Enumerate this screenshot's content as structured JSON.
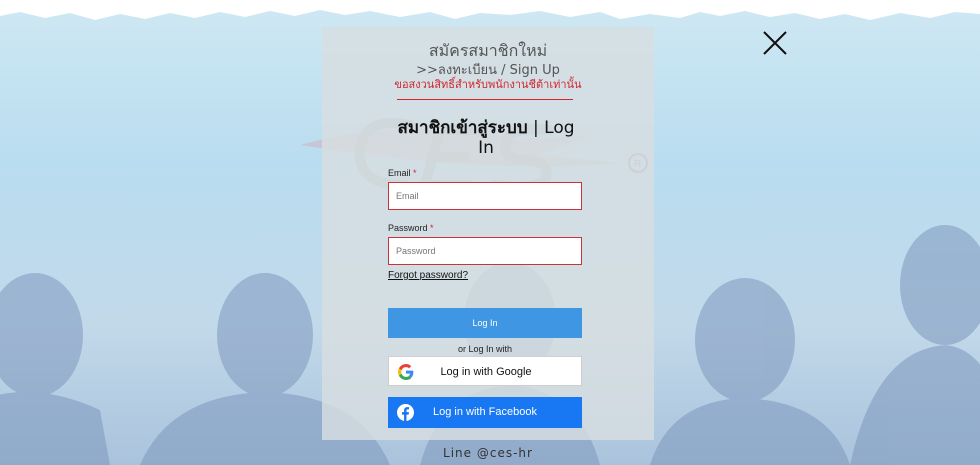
{
  "signup": {
    "title": "สมัครสมาชิกใหม่",
    "link": ">>ลงทะเบียน / Sign Up",
    "note": "ขอสงวนสิทธิ์สำหรับพนักงานชีต้าเท่านั้น"
  },
  "login": {
    "title_thai": "สมาชิกเข้าสู่ระบบ",
    "title_en": " | Log In",
    "email": {
      "label": "Email",
      "required_mark": "*",
      "placeholder": "Email",
      "value": ""
    },
    "password": {
      "label": "Password",
      "required_mark": "*",
      "placeholder": "Password",
      "value": ""
    },
    "forgot_label": "Forgot password?",
    "submit_label": "Log In",
    "or_text": "or Log In with",
    "google_label": "Log in with Google",
    "facebook_label": "Log in with Facebook"
  },
  "footer": {
    "line_id": "Line @ces-hr"
  },
  "icons": [
    "close-icon",
    "google-icon",
    "facebook-icon",
    "ces-logo"
  ],
  "colors": {
    "accent_red": "#d1262c",
    "login_button": "#3f97e3",
    "facebook_blue": "#1877f2",
    "panel": "#d7dee0"
  }
}
